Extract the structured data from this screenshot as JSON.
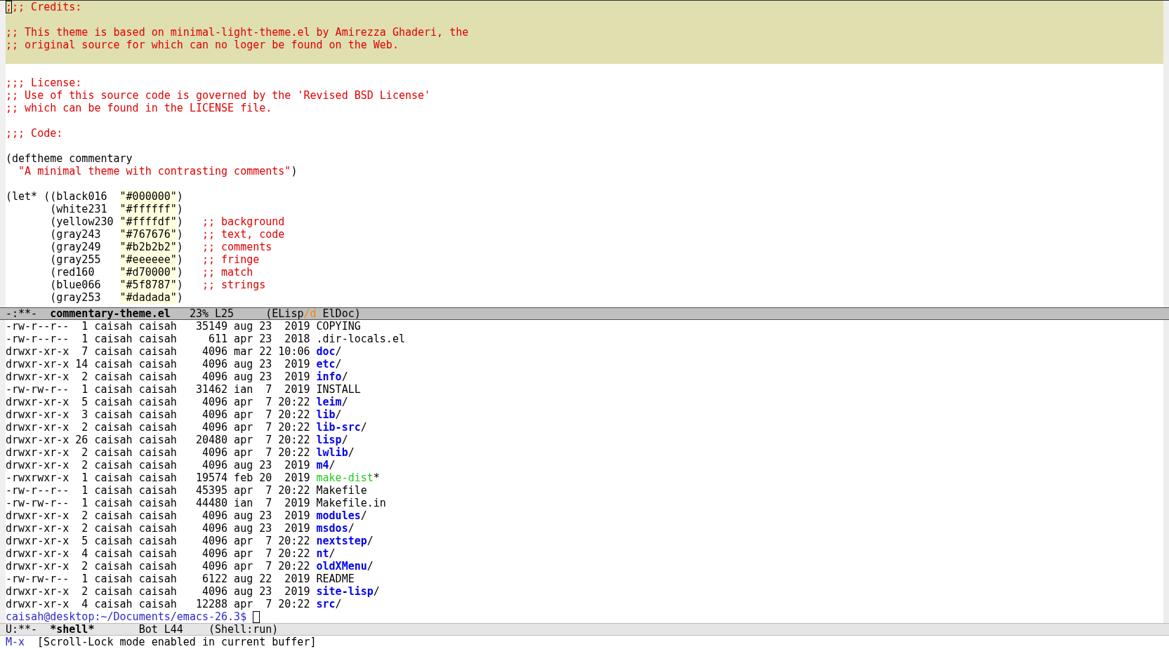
{
  "editor": {
    "lines": [
      {
        "highlighted": true,
        "segments": [
          {
            "kind": "comment",
            "text": ";",
            "cursor": true
          },
          {
            "kind": "comment",
            "text": ";; Credits:"
          }
        ]
      },
      {
        "highlighted": true
      },
      {
        "highlighted": true,
        "segments": [
          {
            "kind": "comment",
            "text": ";; This theme is based on minimal-light-theme.el by Amirezza Ghaderi, the"
          }
        ]
      },
      {
        "highlighted": true,
        "segments": [
          {
            "kind": "comment",
            "text": ";; original source for which can no loger be found on the Web."
          }
        ]
      },
      {
        "highlighted": true
      },
      {
        "highlighted": false
      },
      {
        "highlighted": false,
        "segments": [
          {
            "kind": "comment",
            "text": ";;; License:"
          }
        ]
      },
      {
        "highlighted": false,
        "segments": [
          {
            "kind": "comment",
            "text": ";; Use of this source code is governed by the 'Revised BSD License'"
          }
        ]
      },
      {
        "highlighted": false,
        "segments": [
          {
            "kind": "comment",
            "text": ";; which can be found in the LICENSE file."
          }
        ]
      },
      {
        "highlighted": false
      },
      {
        "highlighted": false,
        "segments": [
          {
            "kind": "comment",
            "text": ";;; Code:"
          }
        ]
      },
      {
        "highlighted": false
      },
      {
        "highlighted": false,
        "segments": [
          {
            "kind": "code",
            "text": "(deftheme commentary"
          }
        ]
      },
      {
        "highlighted": false,
        "segments": [
          {
            "kind": "string",
            "text": "  \"A minimal theme with contrasting comments\""
          },
          {
            "kind": "code",
            "text": ")"
          }
        ]
      },
      {
        "highlighted": false
      },
      {
        "highlighted": false,
        "segments": [
          {
            "kind": "code",
            "text": "(let* ((black016  "
          },
          {
            "kind": "color-string",
            "text": "\"#000000\""
          },
          {
            "kind": "code",
            "text": ")"
          }
        ]
      },
      {
        "highlighted": false,
        "segments": [
          {
            "kind": "code",
            "text": "       (white231  "
          },
          {
            "kind": "color-string",
            "text": "\"#ffffff\""
          },
          {
            "kind": "code",
            "text": ")"
          }
        ]
      },
      {
        "highlighted": false,
        "segments": [
          {
            "kind": "code",
            "text": "       (yellow230 "
          },
          {
            "kind": "color-string",
            "text": "\"#ffffdf\""
          },
          {
            "kind": "code",
            "text": ")   "
          },
          {
            "kind": "comment",
            "text": ";; background"
          }
        ]
      },
      {
        "highlighted": false,
        "segments": [
          {
            "kind": "code",
            "text": "       (gray243   "
          },
          {
            "kind": "color-string",
            "text": "\"#767676\""
          },
          {
            "kind": "code",
            "text": ")   "
          },
          {
            "kind": "comment",
            "text": ";; text, code"
          }
        ]
      },
      {
        "highlighted": false,
        "segments": [
          {
            "kind": "code",
            "text": "       (gray249   "
          },
          {
            "kind": "color-string",
            "text": "\"#b2b2b2\""
          },
          {
            "kind": "code",
            "text": ")   "
          },
          {
            "kind": "comment",
            "text": ";; comments"
          }
        ]
      },
      {
        "highlighted": false,
        "segments": [
          {
            "kind": "code",
            "text": "       (gray255   "
          },
          {
            "kind": "color-string",
            "text": "\"#eeeeee\""
          },
          {
            "kind": "code",
            "text": ")   "
          },
          {
            "kind": "comment",
            "text": ";; fringe"
          }
        ]
      },
      {
        "highlighted": false,
        "segments": [
          {
            "kind": "code",
            "text": "       (red160    "
          },
          {
            "kind": "color-string",
            "text": "\"#d70000\""
          },
          {
            "kind": "code",
            "text": ")   "
          },
          {
            "kind": "comment",
            "text": ";; match"
          }
        ]
      },
      {
        "highlighted": false,
        "segments": [
          {
            "kind": "code",
            "text": "       (blue066   "
          },
          {
            "kind": "color-string",
            "text": "\"#5f8787\""
          },
          {
            "kind": "code",
            "text": ")   "
          },
          {
            "kind": "comment",
            "text": ";; strings"
          }
        ]
      },
      {
        "highlighted": false,
        "segments": [
          {
            "kind": "code",
            "text": "       (gray253   "
          },
          {
            "kind": "color-string",
            "text": "\"#dadada\""
          },
          {
            "kind": "code",
            "text": ")"
          }
        ]
      }
    ],
    "mode_line": {
      "active": true,
      "segments": [
        {
          "kind": "plain",
          "text": "-:**-  "
        },
        {
          "kind": "bold",
          "text": "commentary-theme.el"
        },
        {
          "kind": "plain",
          "text": "   23% L25     (ELisp"
        },
        {
          "kind": "accent",
          "text": "/d"
        },
        {
          "kind": "plain",
          "text": " ElDoc)"
        }
      ]
    }
  },
  "shell": {
    "rows": [
      {
        "info": "-rw-r--r--  1 caisah caisah   35149 aug 23  2019",
        "kind": "file",
        "name": "COPYING"
      },
      {
        "info": "-rw-r--r--  1 caisah caisah     611 apr 23  2018",
        "kind": "file",
        "name": ".dir-locals.el"
      },
      {
        "info": "drwxr-xr-x  7 caisah caisah    4096 mar 22 10:06",
        "kind": "dir",
        "name": "doc",
        "suffix": "/"
      },
      {
        "info": "drwxr-xr-x 14 caisah caisah    4096 aug 23  2019",
        "kind": "dir",
        "name": "etc",
        "suffix": "/"
      },
      {
        "info": "drwxr-xr-x  2 caisah caisah    4096 aug 23  2019",
        "kind": "dir",
        "name": "info",
        "suffix": "/"
      },
      {
        "info": "-rw-rw-r--  1 caisah caisah   31462 ian  7  2019",
        "kind": "file",
        "name": "INSTALL"
      },
      {
        "info": "drwxr-xr-x  5 caisah caisah    4096 apr  7 20:22",
        "kind": "dir",
        "name": "leim",
        "suffix": "/"
      },
      {
        "info": "drwxr-xr-x  3 caisah caisah    4096 apr  7 20:22",
        "kind": "dir",
        "name": "lib",
        "suffix": "/"
      },
      {
        "info": "drwxr-xr-x  2 caisah caisah    4096 apr  7 20:22",
        "kind": "dir",
        "name": "lib-src",
        "suffix": "/"
      },
      {
        "info": "drwxr-xr-x 26 caisah caisah   20480 apr  7 20:22",
        "kind": "dir",
        "name": "lisp",
        "suffix": "/"
      },
      {
        "info": "drwxr-xr-x  2 caisah caisah    4096 apr  7 20:22",
        "kind": "dir",
        "name": "lwlib",
        "suffix": "/"
      },
      {
        "info": "drwxr-xr-x  2 caisah caisah    4096 aug 23  2019",
        "kind": "dir",
        "name": "m4",
        "suffix": "/"
      },
      {
        "info": "-rwxrwxr-x  1 caisah caisah   19574 feb 20  2019",
        "kind": "exec",
        "name": "make-dist",
        "suffix": "*"
      },
      {
        "info": "-rw-r--r--  1 caisah caisah   45395 apr  7 20:22",
        "kind": "file",
        "name": "Makefile"
      },
      {
        "info": "-rw-rw-r--  1 caisah caisah   44480 ian  7  2019",
        "kind": "file",
        "name": "Makefile.in"
      },
      {
        "info": "drwxr-xr-x  2 caisah caisah    4096 aug 23  2019",
        "kind": "dir",
        "name": "modules",
        "suffix": "/"
      },
      {
        "info": "drwxr-xr-x  2 caisah caisah    4096 aug 23  2019",
        "kind": "dir",
        "name": "msdos",
        "suffix": "/"
      },
      {
        "info": "drwxr-xr-x  5 caisah caisah    4096 apr  7 20:22",
        "kind": "dir",
        "name": "nextstep",
        "suffix": "/"
      },
      {
        "info": "drwxr-xr-x  4 caisah caisah    4096 apr  7 20:22",
        "kind": "dir",
        "name": "nt",
        "suffix": "/"
      },
      {
        "info": "drwxr-xr-x  2 caisah caisah    4096 apr  7 20:22",
        "kind": "dir",
        "name": "oldXMenu",
        "suffix": "/"
      },
      {
        "info": "-rw-rw-r--  1 caisah caisah    6122 aug 22  2019",
        "kind": "file",
        "name": "README"
      },
      {
        "info": "drwxr-xr-x  2 caisah caisah    4096 aug 23  2019",
        "kind": "dir",
        "name": "site-lisp",
        "suffix": "/"
      },
      {
        "info": "drwxr-xr-x  4 caisah caisah   12288 apr  7 20:22",
        "kind": "dir",
        "name": "src",
        "suffix": "/"
      }
    ],
    "prompt": "caisah@desktop:~/Documents/emacs-26.3$",
    "mode_line": {
      "active": false,
      "segments": [
        {
          "kind": "plain",
          "text": "U:**-  "
        },
        {
          "kind": "bold",
          "text": "*shell*"
        },
        {
          "kind": "plain",
          "text": "       Bot L44    (Shell:run)"
        }
      ]
    }
  },
  "echo_area": {
    "command": "M-x",
    "message": "[Scroll-Lock mode enabled in current buffer]"
  }
}
